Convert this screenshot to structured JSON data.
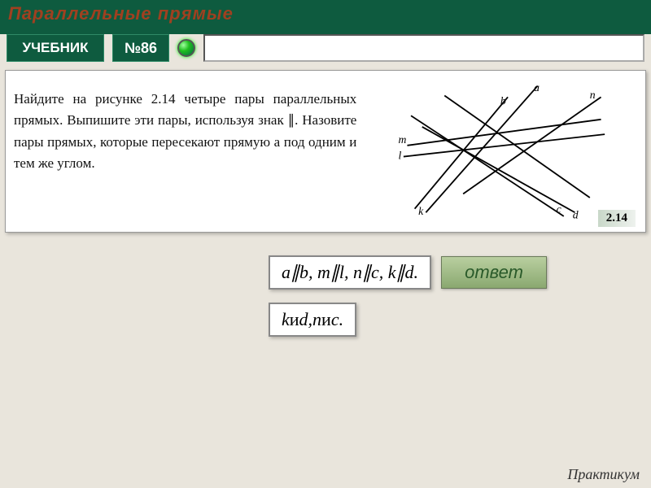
{
  "header": {
    "title": "Параллельные прямые"
  },
  "toolbar": {
    "textbook_label": "УЧЕБНИК",
    "number_label": "№86",
    "search_value": ""
  },
  "problem": {
    "text": "Найдите на рисунке 2.14 четыре пары параллельных прямых. Выпишите эти пары, используя знак ∥. Назовите пары прямых, которые пересекают прямую a под одним и тем же углом.",
    "figure_label": "2.14",
    "figure_lines": [
      "a",
      "b",
      "m",
      "l",
      "n",
      "k",
      "c",
      "d"
    ]
  },
  "answers": {
    "line1": "a∥b,  m∥l,  n∥c,  k∥d.",
    "line2_parts": [
      "k",
      " и ",
      "d, ",
      "n",
      " и ",
      "c."
    ],
    "button_label": "ответ"
  },
  "footer": {
    "label": "Практикум"
  }
}
